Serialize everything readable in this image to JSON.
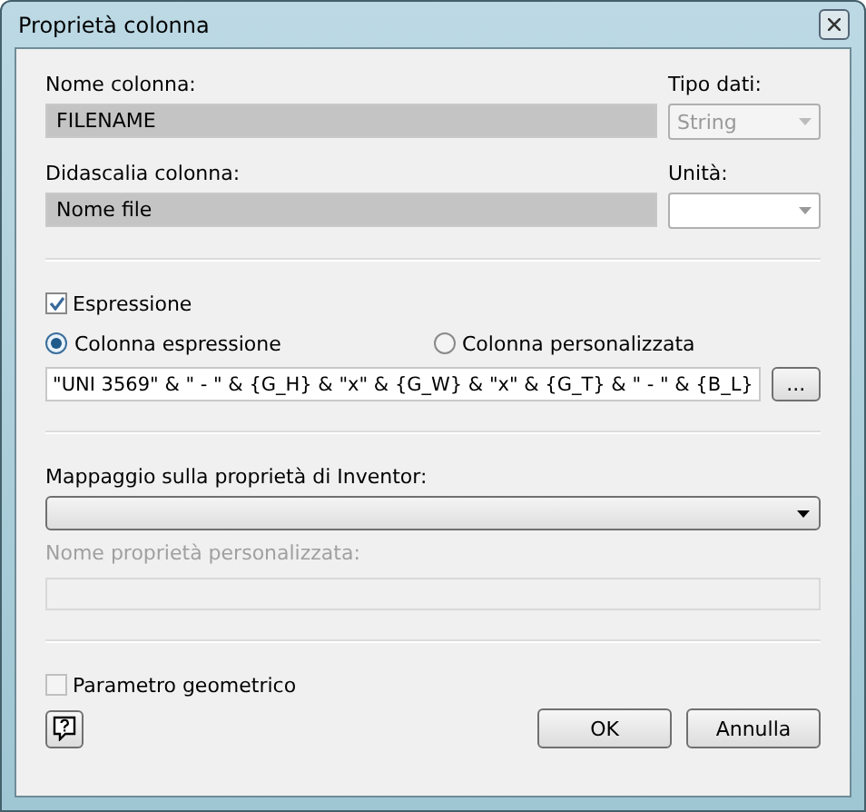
{
  "window": {
    "title": "Proprietà colonna"
  },
  "column": {
    "name_label": "Nome colonna:",
    "name_value": "FILENAME",
    "type_label": "Tipo dati:",
    "type_value": "String",
    "type_disabled": true,
    "caption_label": "Didascalia colonna:",
    "caption_value": "Nome file",
    "unit_label": "Unità:",
    "unit_disabled": false
  },
  "expression": {
    "checkbox": {
      "label": "Espressione",
      "checked": true,
      "disabled": false
    },
    "radios": [
      {
        "label": "Colonna espressione",
        "selected": true
      },
      {
        "label": "Colonna personalizzata",
        "selected": false
      }
    ],
    "value": "\"UNI 3569\" & \" - \" & {G_H} & \"x\" & {G_W} & \"x\" & {G_T} & \" - \" & {B_L}",
    "browse_button": "..."
  },
  "mapping": {
    "label": "Mappaggio sulla proprietà di Inventor:",
    "custom_label": "Nome proprietà personalizzata:",
    "custom_disabled": true
  },
  "geometric": {
    "label": "Parametro geometrico",
    "checked": false,
    "disabled": true
  },
  "buttons": [
    "OK",
    "Annulla"
  ]
}
